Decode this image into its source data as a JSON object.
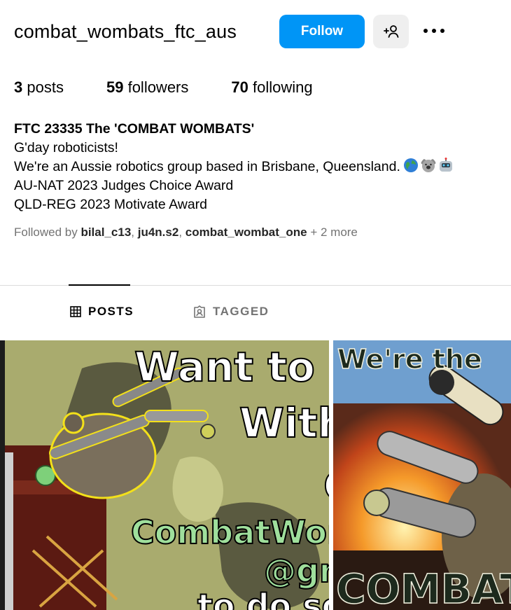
{
  "profile": {
    "username": "combat_wombats_ftc_aus",
    "follow_label": "Follow",
    "stats": [
      {
        "count": "3",
        "label": "posts"
      },
      {
        "count": "59",
        "label": "followers"
      },
      {
        "count": "70",
        "label": "following"
      }
    ],
    "bio": {
      "name": "FTC 23335 The 'COMBAT WOMBATS'",
      "lines": [
        "G'day roboticists!",
        "We're an Aussie robotics group based in Brisbane, Queensland.",
        "AU-NAT 2023 Judges Choice Award",
        "QLD-REG 2023 Motivate Award"
      ],
      "emojis": [
        "globe-emoji",
        "koala-emoji",
        "robot-emoji"
      ]
    },
    "followed_by": {
      "prefix": "Followed by",
      "users": [
        "bilal_c13",
        "ju4n.s2",
        "combat_wombat_one"
      ],
      "more": "+ 2 more"
    }
  },
  "tabs": [
    {
      "label": "POSTS",
      "icon": "grid-icon",
      "active": true
    },
    {
      "label": "TAGGED",
      "icon": "tagged-icon",
      "active": false
    }
  ],
  "posts": [
    {
      "image_text": [
        "Want to",
        "With",
        "C",
        "CombatWomb",
        "@gm",
        "to do so"
      ]
    },
    {
      "image_text": [
        "We're the",
        "COMBAT"
      ]
    }
  ],
  "colors": {
    "follow_blue": "#0095f6",
    "secondary_text": "#737373",
    "divider": "#dbdbdb",
    "post1_bg": "#a9ab6e",
    "post2_sky": "#6f9fcf",
    "logo_green": "#9fdf9c"
  }
}
